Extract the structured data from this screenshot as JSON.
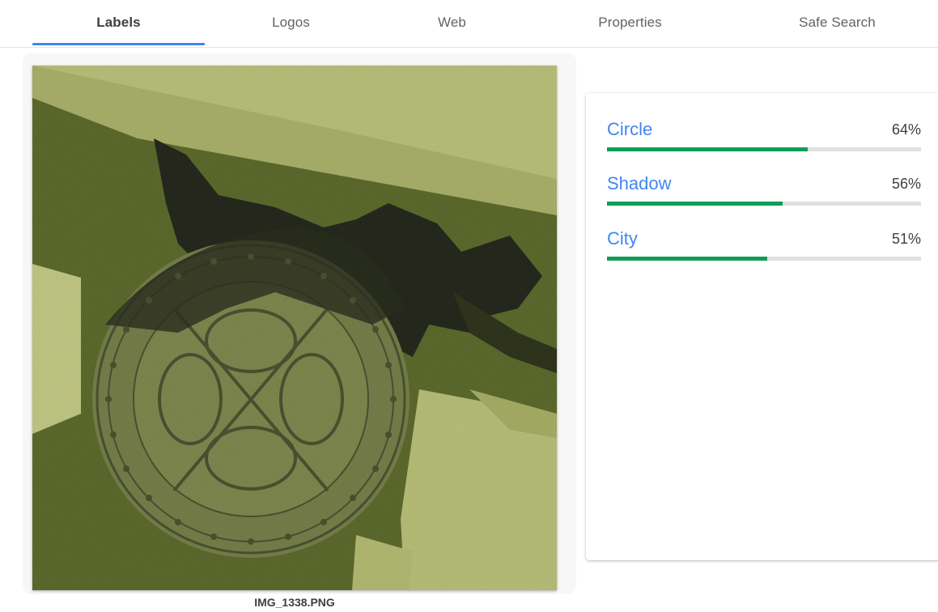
{
  "tabs": [
    {
      "label": "Labels",
      "active": true
    },
    {
      "label": "Logos",
      "active": false
    },
    {
      "label": "Web",
      "active": false
    },
    {
      "label": "Properties",
      "active": false
    },
    {
      "label": "Safe Search",
      "active": false
    }
  ],
  "image": {
    "caption": "IMG_1338.PNG"
  },
  "labels": [
    {
      "name": "Circle",
      "score": "64%",
      "fraction": 0.64
    },
    {
      "name": "Shadow",
      "score": "56%",
      "fraction": 0.56
    },
    {
      "name": "City",
      "score": "51%",
      "fraction": 0.51
    }
  ],
  "colors": {
    "accent": "#4285f4",
    "bar_fill": "#0f9d58",
    "bar_track": "#e0e0e0"
  }
}
